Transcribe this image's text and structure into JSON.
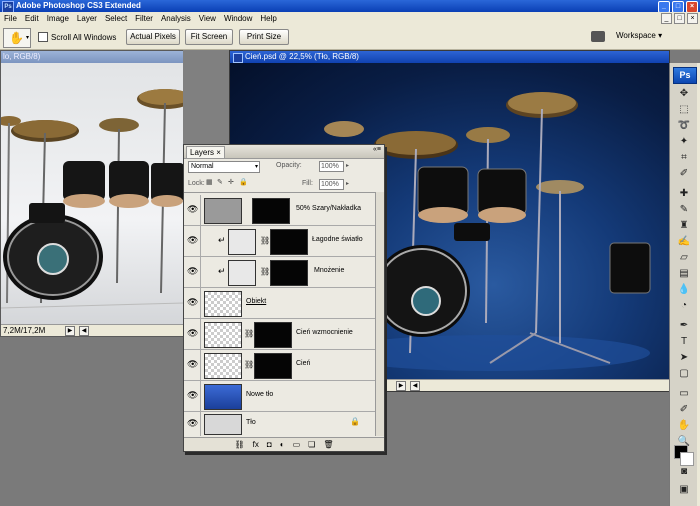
{
  "window": {
    "title": "Adobe Photoshop CS3 Extended",
    "app_icon": "Ps"
  },
  "menu": [
    "File",
    "Edit",
    "Image",
    "Layer",
    "Select",
    "Filter",
    "Analysis",
    "View",
    "Window",
    "Help"
  ],
  "options_bar": {
    "scroll_all_windows": "Scroll All Windows",
    "actual_pixels": "Actual Pixels",
    "fit_screen": "Fit Screen",
    "print_size": "Print Size",
    "workspace": "Workspace ▾"
  },
  "doc_left": {
    "title": "lo, RGB/8)",
    "status": "7,2M/17,2M"
  },
  "doc_right": {
    "title": "Cień.psd @ 22,5% (Tło, RGB/8)"
  },
  "layers_panel": {
    "tab": "Layers",
    "blend_mode": "Normal",
    "opacity_label": "Opacity:",
    "opacity_value": "100%",
    "lock_label": "Lock:",
    "fill_label": "Fill:",
    "fill_value": "100%",
    "layers": [
      {
        "name": "50% Szary/Nakładka"
      },
      {
        "name": "Łagodne światło"
      },
      {
        "name": "Mnożenie"
      },
      {
        "name": "Obiekt"
      },
      {
        "name": "Cień wzmocnienie"
      },
      {
        "name": "Cień"
      },
      {
        "name": "Nowe tło"
      },
      {
        "name": "Tło"
      }
    ]
  },
  "tools_panel": {
    "logo": "Ps"
  },
  "colors": {
    "titlebar": "#0a3fb5",
    "panel_bg": "#eceae2",
    "workspace_bg": "#7a7a7a",
    "foreground": "#000000",
    "background": "#ffffff"
  }
}
